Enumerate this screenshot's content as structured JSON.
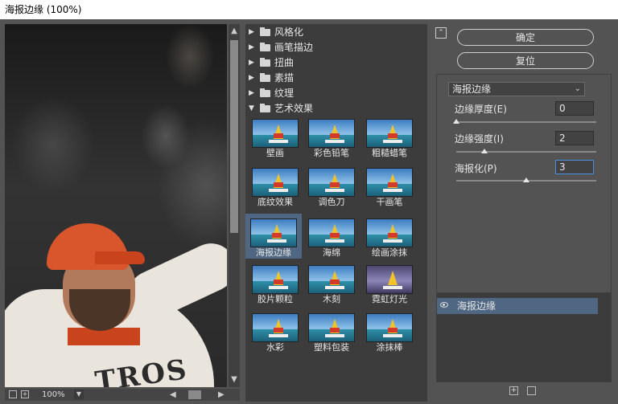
{
  "window": {
    "title": "海报边缘 (100%)"
  },
  "preview": {
    "zoom": "100%",
    "jersey_text": "TROS"
  },
  "categories": [
    {
      "label": "风格化",
      "expanded": false
    },
    {
      "label": "画笔描边",
      "expanded": false
    },
    {
      "label": "扭曲",
      "expanded": false
    },
    {
      "label": "素描",
      "expanded": false
    },
    {
      "label": "纹理",
      "expanded": false
    },
    {
      "label": "艺术效果",
      "expanded": true
    }
  ],
  "filters": [
    "壁画",
    "彩色铅笔",
    "粗糙蜡笔",
    "底纹效果",
    "调色刀",
    "干画笔",
    "海报边缘",
    "海绵",
    "绘画涂抹",
    "胶片颗粒",
    "木刻",
    "霓虹灯光",
    "水彩",
    "塑料包装",
    "涂抹棒"
  ],
  "selected_filter": "海报边缘",
  "buttons": {
    "ok": "确定",
    "reset": "复位"
  },
  "filter_select": "海报边缘",
  "params": [
    {
      "label": "边缘厚度(E)",
      "value": "0",
      "slider": 0.0
    },
    {
      "label": "边缘强度(I)",
      "value": "2",
      "slider": 0.2
    },
    {
      "label": "海报化(P)",
      "value": "3",
      "slider": 0.5
    }
  ],
  "layer": {
    "label": "海报边缘"
  },
  "icons": {
    "collapse": "collapse-icon",
    "new_layer": "add-layer-icon",
    "delete_layer": "trash-icon",
    "eye": "eye-icon"
  }
}
